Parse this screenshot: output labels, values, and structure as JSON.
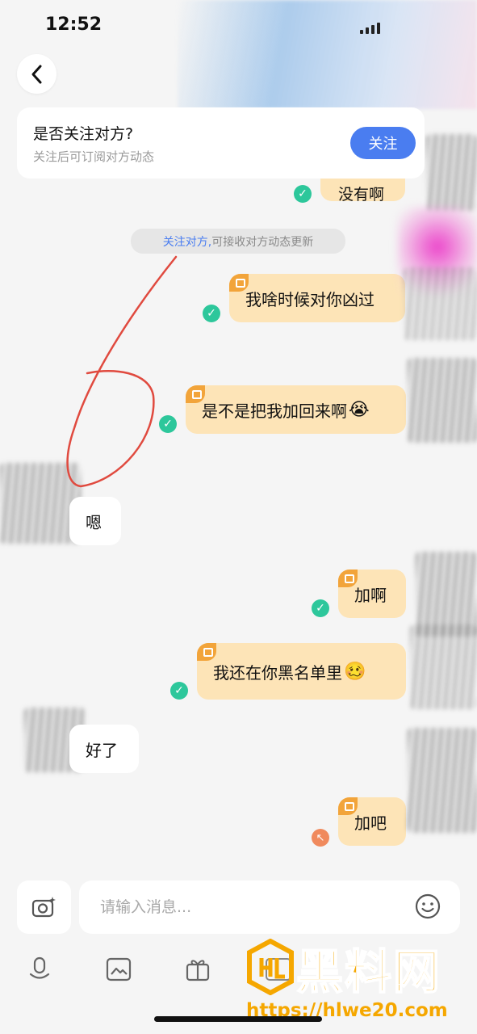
{
  "status_bar": {
    "time": "12:52"
  },
  "follow_prompt": {
    "title": "是否关注对方?",
    "subtitle": "关注后可订阅对方动态",
    "button_label": "关注"
  },
  "chat": {
    "partial_top_text": "没有啊",
    "system_note": {
      "link": "关注对方,",
      "text": "可接收对方动态更新"
    },
    "messages": [
      {
        "direction": "out",
        "text": "我啥时候对你凶过",
        "status": "read"
      },
      {
        "direction": "out",
        "text": "是不是把我加回来啊",
        "emoji": "😭",
        "status": "read"
      },
      {
        "direction": "in",
        "text": "嗯"
      },
      {
        "direction": "out",
        "text": "加啊",
        "status": "read"
      },
      {
        "direction": "out",
        "text": "我还在你黑名单里",
        "emoji": "🥴",
        "status": "read"
      },
      {
        "direction": "in",
        "text": "好了"
      },
      {
        "direction": "out",
        "text": "加吧",
        "status": "pending"
      }
    ]
  },
  "input": {
    "placeholder": "请输入消息..."
  },
  "toolbar": {
    "icons": [
      "microphone-icon",
      "image-icon",
      "gift-icon",
      "gif-icon"
    ]
  },
  "watermark": {
    "title": "黑料网",
    "url": "https://hlwe20.com"
  },
  "colors": {
    "accent": "#4a7df0",
    "outgoing_bubble": "#fde4b7",
    "read_check": "#2dc79b",
    "pending": "#f08a5d"
  }
}
